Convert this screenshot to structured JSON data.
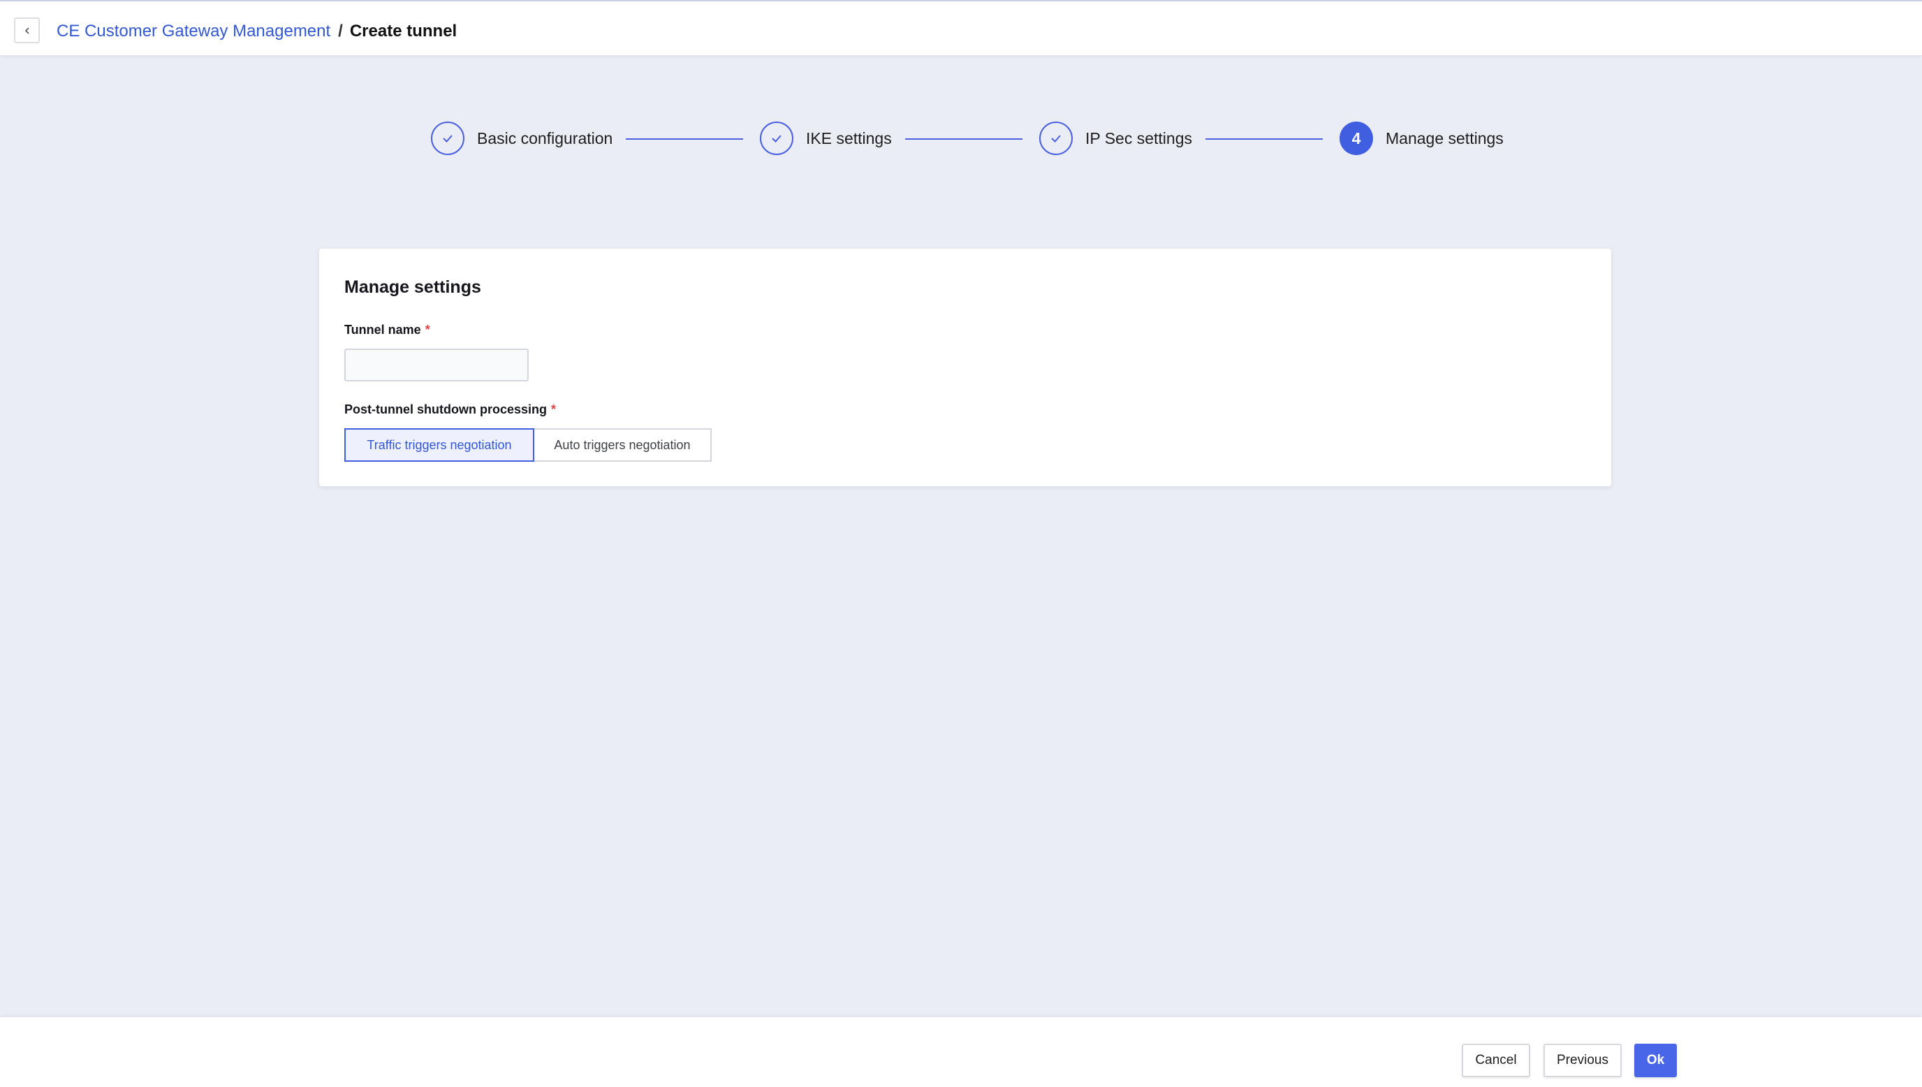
{
  "header": {
    "back_icon": "chevron-left-icon",
    "breadcrumb": {
      "parent": "CE Customer Gateway Management",
      "separator": "/",
      "current": "Create tunnel"
    }
  },
  "stepper": {
    "steps": [
      {
        "label": "Basic configuration",
        "status": "done"
      },
      {
        "label": "IKE settings",
        "status": "done"
      },
      {
        "label": "IP Sec settings",
        "status": "done"
      },
      {
        "label": "Manage settings",
        "status": "active",
        "number": "4"
      }
    ]
  },
  "card": {
    "title": "Manage settings",
    "tunnel_name": {
      "label": "Tunnel name",
      "required_mark": "*",
      "value": ""
    },
    "shutdown_processing": {
      "label": "Post-tunnel shutdown processing",
      "required_mark": "*",
      "options": [
        "Traffic triggers negotiation",
        "Auto triggers negotiation"
      ],
      "selected": "Traffic triggers negotiation"
    }
  },
  "footer": {
    "cancel_label": "Cancel",
    "previous_label": "Previous",
    "ok_label": "Ok"
  },
  "colors": {
    "accent": "#3f5ee0",
    "link": "#3358d4",
    "background": "#ebedf5",
    "required": "#e54545"
  }
}
